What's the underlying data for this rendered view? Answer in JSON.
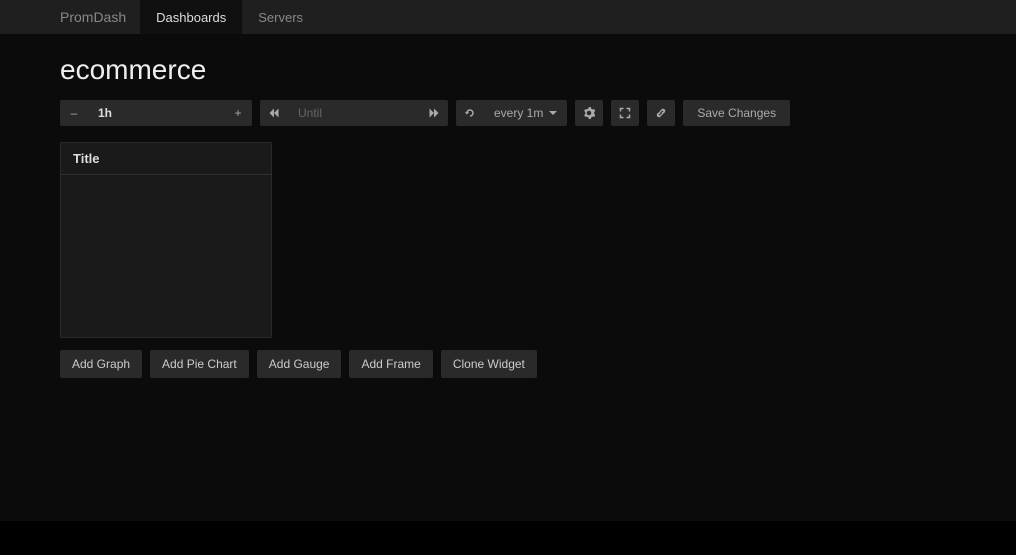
{
  "nav": {
    "brand": "PromDash",
    "items": [
      {
        "label": "Dashboards",
        "active": true
      },
      {
        "label": "Servers",
        "active": false
      }
    ]
  },
  "dashboard": {
    "title": "ecommerce"
  },
  "toolbar": {
    "minus": "–",
    "range_value": "1h",
    "plus": "+",
    "until_placeholder": "Until",
    "refresh_interval": "every 1m",
    "save_label": "Save Changes"
  },
  "widget": {
    "title": "Title"
  },
  "actions": {
    "add_graph": "Add Graph",
    "add_pie": "Add Pie Chart",
    "add_gauge": "Add Gauge",
    "add_frame": "Add Frame",
    "clone_widget": "Clone Widget"
  }
}
